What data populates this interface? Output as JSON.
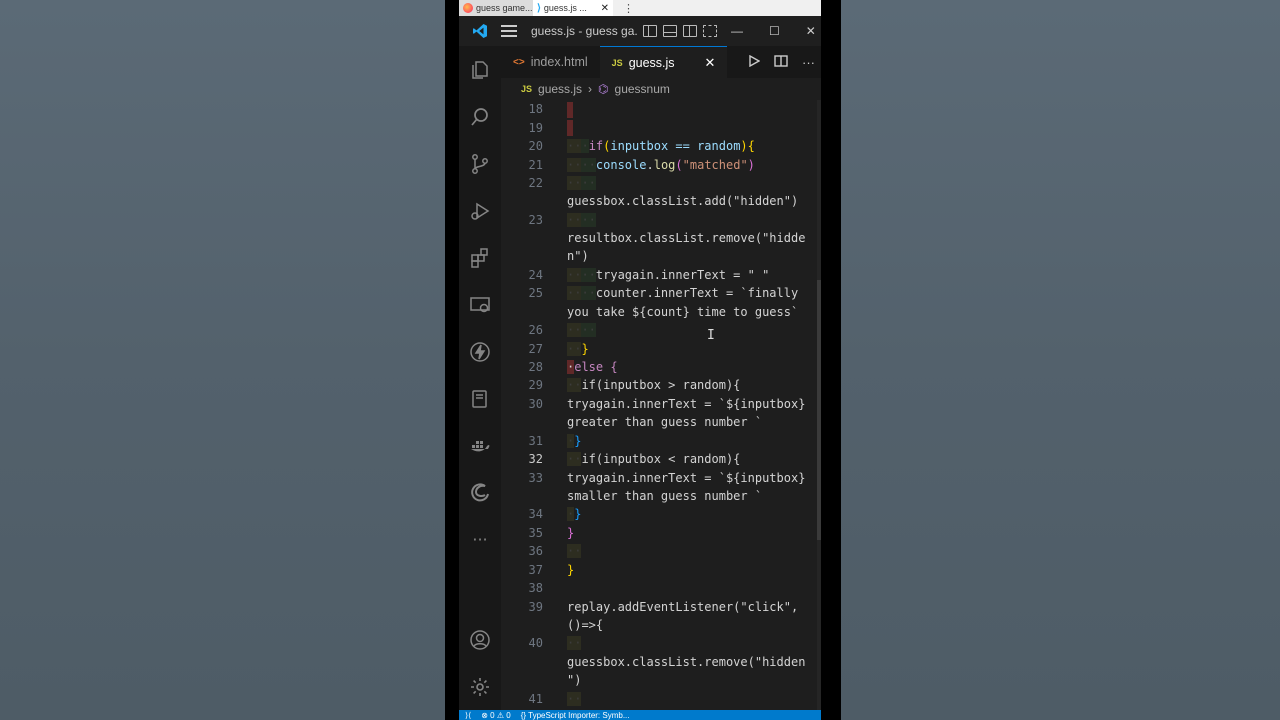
{
  "browser": {
    "tabs": [
      {
        "label": "guess game...",
        "active": false
      },
      {
        "label": "guess.js ...",
        "active": true
      }
    ]
  },
  "window": {
    "title": "guess.js - guess ga..."
  },
  "activity_bar": {
    "items": [
      "explorer-icon",
      "search-icon",
      "source-control-icon",
      "run-debug-icon",
      "extensions-icon",
      "remote-explorer-icon",
      "thunder-client-icon",
      "book-icon",
      "docker-icon",
      "edge-icon",
      "more-icon"
    ],
    "bottom": [
      "account-icon",
      "settings-icon"
    ]
  },
  "editor": {
    "tabs": [
      {
        "label": "index.html",
        "icon": "<>",
        "active": false
      },
      {
        "label": "guess.js",
        "icon": "JS",
        "active": true
      }
    ],
    "breadcrumb": {
      "file": "guess.js",
      "symbol": "guessnum",
      "file_icon": "JS"
    },
    "current_line": "32",
    "line_numbers": [
      "18",
      "19",
      "20",
      "21",
      "22",
      "23",
      "24",
      "25",
      "26",
      "27",
      "28",
      "29",
      "30",
      "31",
      "32",
      "33",
      "34",
      "35",
      "36",
      "37",
      "38",
      "39",
      "40",
      "41"
    ]
  },
  "code_lines": {
    "l20": "if(inputbox == random){",
    "l21": "console.log(\"matched\")",
    "l22": "guessbox.classList.add(\"hidden\")",
    "l23a": "resultbox.classList.remove(\"hidde",
    "l23b": "n\")",
    "l24": "tryagain.innerText = \" \"",
    "l25a": "counter.innerText = `finally",
    "l25b": "you take ${count} time to guess`",
    "l27": "}",
    "l28": "else {",
    "l29": "if(inputbox > random){",
    "l30a": "tryagain.innerText = `${inputbox}",
    "l30b": "greater than guess number `",
    "l31": "}",
    "l32": "if(inputbox < random){",
    "l33a": "tryagain.innerText = `${inputbox}",
    "l33b": "smaller than guess number `",
    "l34": "}",
    "l35": "}",
    "l37": "}",
    "l39a": "replay.addEventListener(\"click\",",
    "l39b": "()=>{",
    "l40a": "guessbox.classList.remove(\"hidden",
    "l40b": "\")"
  },
  "statusbar": {
    "problems": "⊗ 0 ⚠ 0",
    "language_info": "{} TypeScript Importer: Symb..."
  },
  "colors": {
    "accent": "#007acc",
    "editor_bg": "#1e1e1e",
    "keyword": "#c586c0",
    "variable": "#9cdcfe",
    "function": "#dcdcaa",
    "string": "#ce9178"
  }
}
